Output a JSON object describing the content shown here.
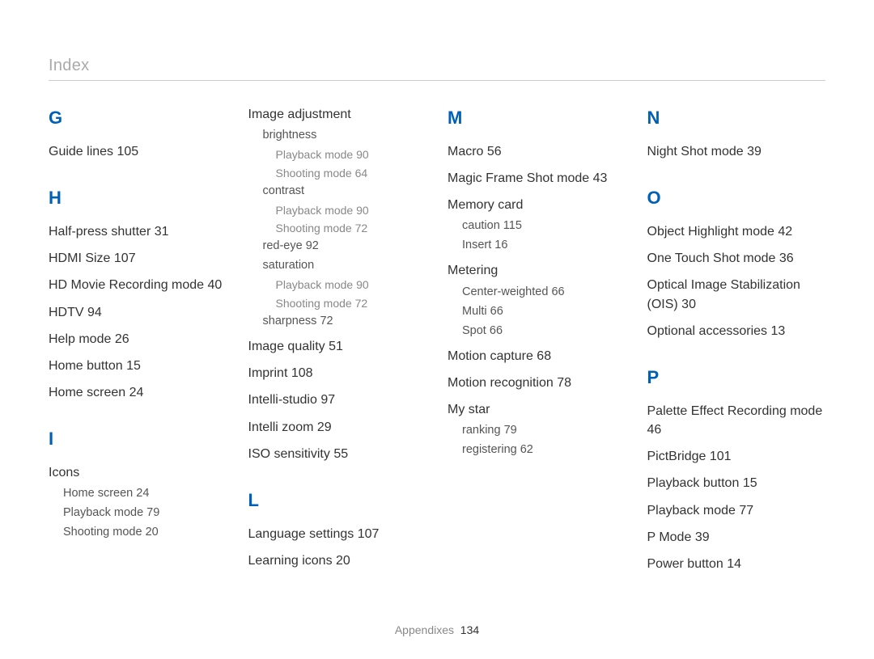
{
  "header": {
    "title": "Index"
  },
  "footer": {
    "label": "Appendixes",
    "page": "134"
  },
  "columns": [
    {
      "sections": [
        {
          "letter": "G",
          "items": [
            {
              "type": "entry",
              "text": "Guide lines",
              "page": "105"
            }
          ]
        },
        {
          "letter": "H",
          "spaced": true,
          "items": [
            {
              "type": "entry",
              "text": "Half-press shutter",
              "page": "31"
            },
            {
              "type": "entry",
              "text": "HDMI Size",
              "page": "107"
            },
            {
              "type": "entry",
              "text": "HD Movie Recording mode",
              "page": "40"
            },
            {
              "type": "entry",
              "text": "HDTV",
              "page": "94"
            },
            {
              "type": "entry",
              "text": "Help mode",
              "page": "26"
            },
            {
              "type": "entry",
              "text": "Home button",
              "page": "15"
            },
            {
              "type": "entry",
              "text": "Home screen",
              "page": "24"
            }
          ]
        },
        {
          "letter": "I",
          "spaced": true,
          "items": [
            {
              "type": "group",
              "text": "Icons"
            },
            {
              "type": "sub",
              "text": "Home screen",
              "page": "24"
            },
            {
              "type": "sub",
              "text": "Playback mode",
              "page": "79"
            },
            {
              "type": "sub",
              "text": "Shooting mode",
              "page": "20"
            }
          ]
        }
      ]
    },
    {
      "sections": [
        {
          "letter": "",
          "items": [
            {
              "type": "group",
              "text": "Image adjustment"
            },
            {
              "type": "sub",
              "text": "brightness"
            },
            {
              "type": "sub2",
              "text": "Playback mode",
              "page": "90"
            },
            {
              "type": "sub2",
              "text": "Shooting mode",
              "page": "64"
            },
            {
              "type": "sub",
              "text": "contrast"
            },
            {
              "type": "sub2",
              "text": "Playback mode",
              "page": "90"
            },
            {
              "type": "sub2",
              "text": "Shooting mode",
              "page": "72"
            },
            {
              "type": "sub",
              "text": "red-eye",
              "page": "92"
            },
            {
              "type": "sub",
              "text": "saturation"
            },
            {
              "type": "sub2",
              "text": "Playback mode",
              "page": "90"
            },
            {
              "type": "sub2",
              "text": "Shooting mode",
              "page": "72"
            },
            {
              "type": "sub",
              "text": "sharpness",
              "page": "72"
            },
            {
              "type": "gap"
            },
            {
              "type": "entry",
              "text": "Image quality",
              "page": "51"
            },
            {
              "type": "entry",
              "text": "Imprint",
              "page": "108"
            },
            {
              "type": "entry",
              "text": "Intelli-studio",
              "page": "97"
            },
            {
              "type": "entry",
              "text": "Intelli zoom",
              "page": "29"
            },
            {
              "type": "entry",
              "text": "ISO sensitivity",
              "page": "55"
            }
          ]
        },
        {
          "letter": "L",
          "spaced": true,
          "items": [
            {
              "type": "entry",
              "text": "Language settings",
              "page": "107"
            },
            {
              "type": "entry",
              "text": "Learning icons",
              "page": "20"
            }
          ]
        }
      ]
    },
    {
      "sections": [
        {
          "letter": "M",
          "items": [
            {
              "type": "entry",
              "text": "Macro",
              "page": "56"
            },
            {
              "type": "entry",
              "text": "Magic Frame Shot mode",
              "page": "43"
            },
            {
              "type": "group",
              "text": "Memory card"
            },
            {
              "type": "sub",
              "text": "caution",
              "page": "115"
            },
            {
              "type": "sub",
              "text": "Insert",
              "page": "16"
            },
            {
              "type": "gap"
            },
            {
              "type": "group",
              "text": "Metering"
            },
            {
              "type": "sub",
              "text": "Center-weighted",
              "page": "66"
            },
            {
              "type": "sub",
              "text": "Multi",
              "page": "66"
            },
            {
              "type": "sub",
              "text": "Spot",
              "page": "66"
            },
            {
              "type": "gap"
            },
            {
              "type": "entry",
              "text": "Motion capture",
              "page": "68"
            },
            {
              "type": "entry",
              "text": "Motion recognition",
              "page": "78"
            },
            {
              "type": "group",
              "text": "My star"
            },
            {
              "type": "sub",
              "text": "ranking",
              "page": "79"
            },
            {
              "type": "sub",
              "text": "registering",
              "page": "62"
            }
          ]
        }
      ]
    },
    {
      "sections": [
        {
          "letter": "N",
          "items": [
            {
              "type": "entry",
              "text": "Night Shot mode",
              "page": "39"
            }
          ]
        },
        {
          "letter": "O",
          "spaced": true,
          "items": [
            {
              "type": "entry",
              "text": "Object Highlight mode",
              "page": "42"
            },
            {
              "type": "entry",
              "text": "One Touch Shot mode",
              "page": "36"
            },
            {
              "type": "entry",
              "text": "Optical Image Stabilization (OIS)",
              "page": "30"
            },
            {
              "type": "entry",
              "text": "Optional accessories",
              "page": "13"
            }
          ]
        },
        {
          "letter": "P",
          "spaced": true,
          "items": [
            {
              "type": "entry",
              "text": "Palette Effect Recording mode",
              "page": "46"
            },
            {
              "type": "entry",
              "text": "PictBridge",
              "page": "101"
            },
            {
              "type": "entry",
              "text": "Playback button",
              "page": "15"
            },
            {
              "type": "entry",
              "text": "Playback mode",
              "page": "77"
            },
            {
              "type": "entry",
              "text": "P Mode",
              "page": "39"
            },
            {
              "type": "entry",
              "text": "Power button",
              "page": "14"
            }
          ]
        }
      ]
    }
  ]
}
